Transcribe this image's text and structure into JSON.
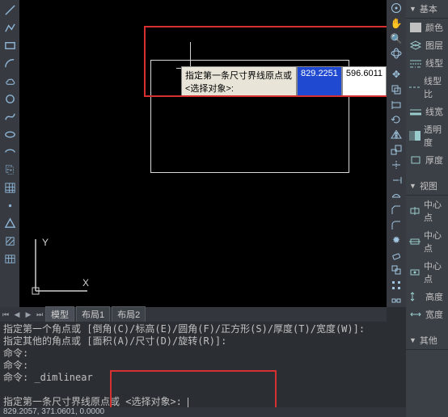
{
  "canvas": {
    "prompt_label": "指定第一条尺寸界线原点或 <选择对象>:",
    "val1": "829.2251",
    "val2": "596.6011"
  },
  "ucs": {
    "x_label": "X",
    "y_label": "Y"
  },
  "tabs": [
    {
      "label": "模型",
      "active": true
    },
    {
      "label": "布局1",
      "active": false
    },
    {
      "label": "布局2",
      "active": false
    }
  ],
  "cmd_history": [
    "指定第一个角点或 [倒角(C)/标高(E)/圆角(F)/正方形(S)/厚度(T)/宽度(W)]:",
    "指定其他的角点或 [面积(A)/尺寸(D)/旋转(R)]:",
    "命令:",
    "命令:",
    "命令: _dimlinear"
  ],
  "cmd_prompt": "指定第一条尺寸界线原点或 <选择对象>: ",
  "status": "829.2057, 371.0601, 0.0000",
  "props": {
    "sections": [
      {
        "title": "基本",
        "items": [
          "颜色",
          "图层",
          "线型",
          "线型比",
          "线宽",
          "透明度",
          "厚度"
        ]
      },
      {
        "title": "视图",
        "items": [
          "中心点",
          "中心点",
          "中心点",
          "高度",
          "宽度"
        ]
      },
      {
        "title": "其他",
        "items": []
      }
    ]
  }
}
